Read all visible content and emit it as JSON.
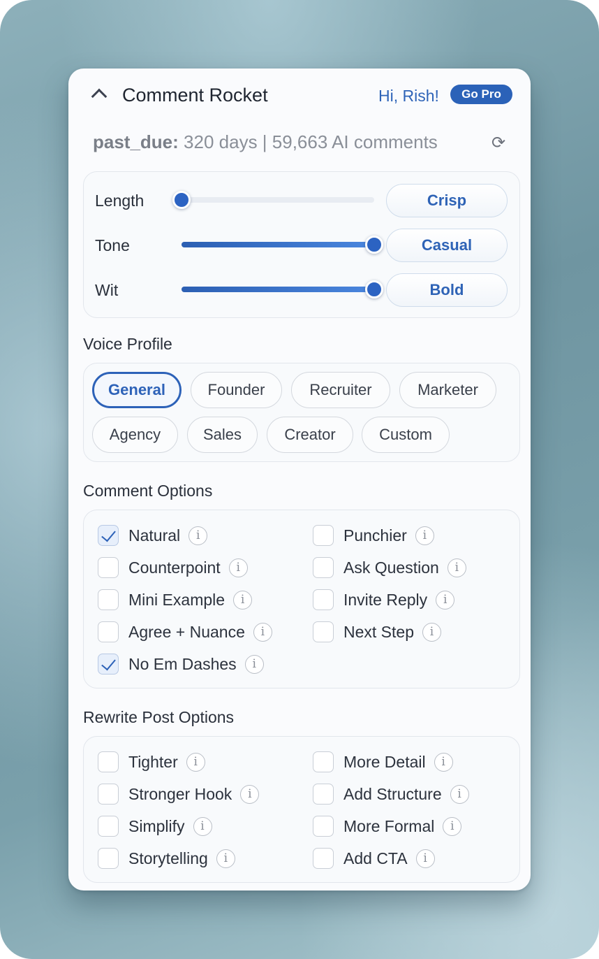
{
  "header": {
    "title": "Comment Rocket",
    "greeting": "Hi, Rish!",
    "pro_badge": "Go Pro"
  },
  "status": {
    "state": "past_due:",
    "details": "320 days | 59,663 AI comments",
    "refresh_icon": "refresh-icon"
  },
  "sliders": [
    {
      "label": "Length",
      "value": 0.0,
      "setting": "Crisp"
    },
    {
      "label": "Tone",
      "value": 1.0,
      "setting": "Casual"
    },
    {
      "label": "Wit",
      "value": 1.0,
      "setting": "Bold"
    }
  ],
  "voice_profile": {
    "title": "Voice Profile",
    "selected": "General",
    "chips": [
      "General",
      "Founder",
      "Recruiter",
      "Marketer",
      "Agency",
      "Sales",
      "Creator",
      "Custom"
    ]
  },
  "comment_options": {
    "title": "Comment Options",
    "items": [
      {
        "label": "Natural",
        "checked": true
      },
      {
        "label": "Punchier",
        "checked": false
      },
      {
        "label": "Counterpoint",
        "checked": false
      },
      {
        "label": "Ask Question",
        "checked": false
      },
      {
        "label": "Mini Example",
        "checked": false
      },
      {
        "label": "Invite Reply",
        "checked": false
      },
      {
        "label": "Agree + Nuance",
        "checked": false
      },
      {
        "label": "Next Step",
        "checked": false
      },
      {
        "label": "No Em Dashes",
        "checked": true
      }
    ]
  },
  "rewrite_options": {
    "title": "Rewrite Post Options",
    "items": [
      {
        "label": "Tighter",
        "checked": false
      },
      {
        "label": "More Detail",
        "checked": false
      },
      {
        "label": "Stronger Hook",
        "checked": false
      },
      {
        "label": "Add Structure",
        "checked": false
      },
      {
        "label": "Simplify",
        "checked": false
      },
      {
        "label": "More Formal",
        "checked": false
      },
      {
        "label": "Storytelling",
        "checked": false
      },
      {
        "label": "Add CTA",
        "checked": false
      }
    ]
  },
  "info_glyph": "i",
  "colors": {
    "accent": "#2d62b8",
    "panel": "#fafbfd",
    "text": "#2a303b"
  }
}
